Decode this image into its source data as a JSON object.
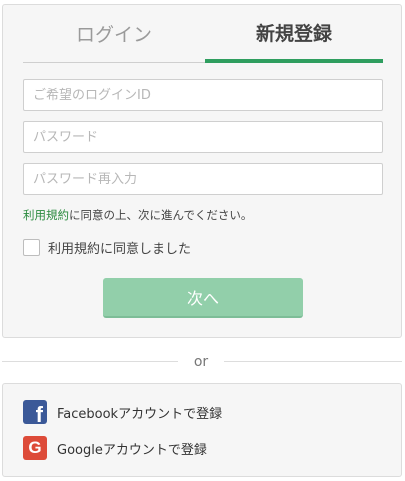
{
  "tabs": {
    "login": "ログイン",
    "register": "新規登録"
  },
  "form": {
    "login_id_placeholder": "ご希望のログインID",
    "password_placeholder": "パスワード",
    "password_confirm_placeholder": "パスワード再入力"
  },
  "terms": {
    "link_text": "利用規約",
    "rest_text": "に同意の上、次に進んでください。",
    "checkbox_label": "利用規約に同意しました"
  },
  "next_button": "次へ",
  "divider_text": "or",
  "social": {
    "facebook_label": "Facebookアカウントで登録",
    "google_label": "Googleアカウントで登録",
    "facebook_icon": "facebook-icon",
    "google_icon": "google-icon",
    "facebook_glyph": "f",
    "google_glyph": "G"
  },
  "colors": {
    "accent_green": "#2f9e5f",
    "button_green": "#92cfaa",
    "link_green": "#2a8a3e",
    "facebook_blue": "#3b5998",
    "google_red": "#dd4b39"
  }
}
